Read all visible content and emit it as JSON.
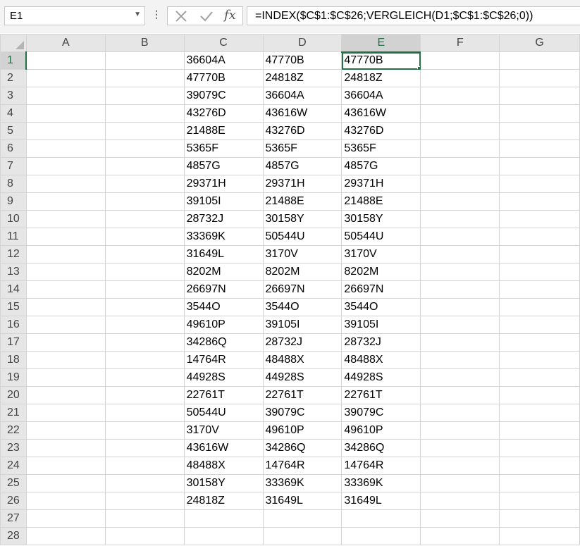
{
  "formula_bar": {
    "name_box": "E1",
    "formula": "=INDEX($C$1:$C$26;VERGLEICH(D1;$C$1:$C$26;0))",
    "fx_label": "fx",
    "cancel_icon": "cancel-icon",
    "enter_icon": "check-icon"
  },
  "sheet": {
    "columns": [
      "A",
      "B",
      "C",
      "D",
      "E",
      "F",
      "G"
    ],
    "selected_column": "E",
    "selected_row": 1,
    "active_cell": "E1",
    "accent_color": "#217346",
    "rows": [
      {
        "num": "1",
        "C": "36604A",
        "D": "47770B",
        "E": "47770B"
      },
      {
        "num": "2",
        "C": "47770B",
        "D": "24818Z",
        "E": "24818Z"
      },
      {
        "num": "3",
        "C": "39079C",
        "D": "36604A",
        "E": "36604A"
      },
      {
        "num": "4",
        "C": "43276D",
        "D": "43616W",
        "E": "43616W"
      },
      {
        "num": "5",
        "C": "21488E",
        "D": "43276D",
        "E": "43276D"
      },
      {
        "num": "6",
        "C": "5365F",
        "D": "5365F",
        "E": "5365F"
      },
      {
        "num": "7",
        "C": "4857G",
        "D": "4857G",
        "E": "4857G"
      },
      {
        "num": "8",
        "C": "29371H",
        "D": "29371H",
        "E": "29371H"
      },
      {
        "num": "9",
        "C": "39105I",
        "D": "21488E",
        "E": "21488E"
      },
      {
        "num": "10",
        "C": "28732J",
        "D": "30158Y",
        "E": "30158Y"
      },
      {
        "num": "11",
        "C": "33369K",
        "D": "50544U",
        "E": "50544U"
      },
      {
        "num": "12",
        "C": "31649L",
        "D": "3170V",
        "E": "3170V"
      },
      {
        "num": "13",
        "C": "8202M",
        "D": "8202M",
        "E": "8202M"
      },
      {
        "num": "14",
        "C": "26697N",
        "D": "26697N",
        "E": "26697N"
      },
      {
        "num": "15",
        "C": "3544O",
        "D": "3544O",
        "E": "3544O"
      },
      {
        "num": "16",
        "C": "49610P",
        "D": "39105I",
        "E": "39105I"
      },
      {
        "num": "17",
        "C": "34286Q",
        "D": "28732J",
        "E": "28732J"
      },
      {
        "num": "18",
        "C": "14764R",
        "D": "48488X",
        "E": "48488X"
      },
      {
        "num": "19",
        "C": "44928S",
        "D": "44928S",
        "E": "44928S"
      },
      {
        "num": "20",
        "C": "22761T",
        "D": "22761T",
        "E": "22761T"
      },
      {
        "num": "21",
        "C": "50544U",
        "D": "39079C",
        "E": "39079C"
      },
      {
        "num": "22",
        "C": "3170V",
        "D": "49610P",
        "E": "49610P"
      },
      {
        "num": "23",
        "C": "43616W",
        "D": "34286Q",
        "E": "34286Q"
      },
      {
        "num": "24",
        "C": "48488X",
        "D": "14764R",
        "E": "14764R"
      },
      {
        "num": "25",
        "C": "30158Y",
        "D": "33369K",
        "E": "33369K"
      },
      {
        "num": "26",
        "C": "24818Z",
        "D": "31649L",
        "E": "31649L"
      },
      {
        "num": "27",
        "C": "",
        "D": "",
        "E": ""
      },
      {
        "num": "28",
        "C": "",
        "D": "",
        "E": ""
      }
    ]
  }
}
